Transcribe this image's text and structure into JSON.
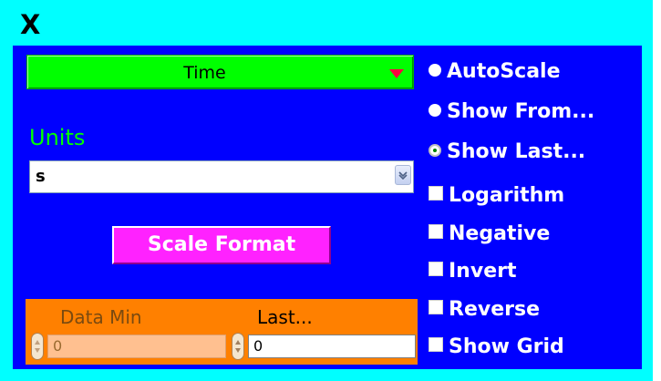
{
  "header": {
    "title": "X"
  },
  "axis_selector": {
    "value": "Time"
  },
  "units": {
    "label": "Units",
    "value": "s"
  },
  "scale_format": {
    "label": "Scale Format"
  },
  "range": {
    "data_min_label": "Data Min",
    "data_min_value": "0",
    "last_label": "Last...",
    "last_value": "0"
  },
  "scale_mode": {
    "options": [
      {
        "label": "AutoScale",
        "selected": false
      },
      {
        "label": "Show From...",
        "selected": false
      },
      {
        "label": "Show Last...",
        "selected": true
      }
    ]
  },
  "options": {
    "checkboxes": [
      {
        "label": "Logarithm",
        "checked": false
      },
      {
        "label": "Negative",
        "checked": false
      },
      {
        "label": "Invert",
        "checked": false
      },
      {
        "label": "Reverse",
        "checked": false
      },
      {
        "label": "Show Grid",
        "checked": false
      }
    ]
  },
  "colors": {
    "frame": "#00ffff",
    "panel": "#0000ff",
    "selector": "#00ff00",
    "accent_magenta": "#ff22ff",
    "range_box": "#ff8000"
  }
}
